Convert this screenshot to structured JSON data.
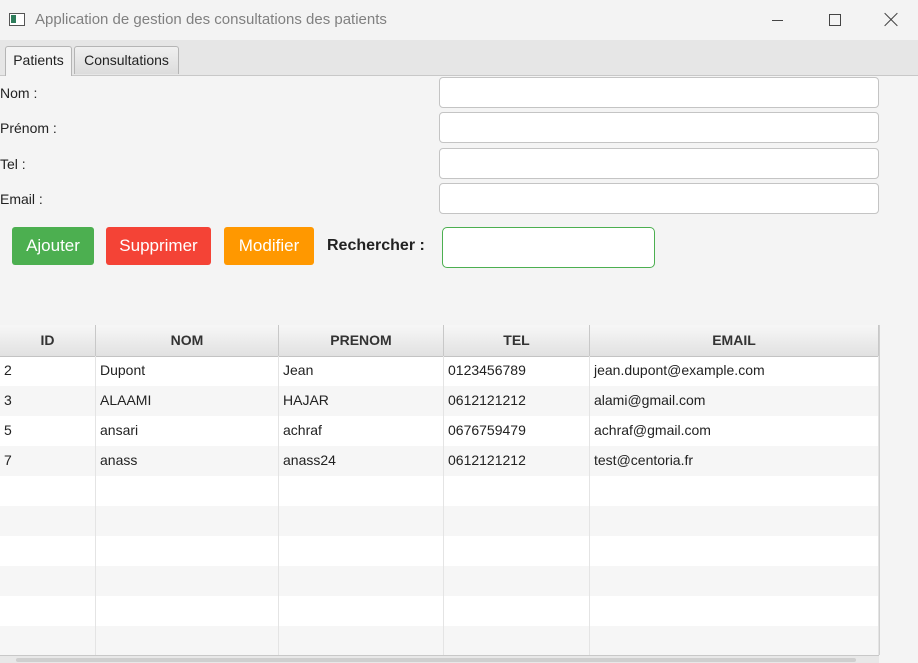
{
  "window": {
    "title": "Application de gestion des consultations des patients"
  },
  "tabs": [
    {
      "label": "Patients"
    },
    {
      "label": "Consultations"
    }
  ],
  "form": {
    "nom_label": "Nom :",
    "prenom_label": "Prénom :",
    "tel_label": "Tel :",
    "email_label": "Email :",
    "nom_value": "",
    "prenom_value": "",
    "tel_value": "",
    "email_value": ""
  },
  "actions": {
    "ajouter": "Ajouter",
    "supprimer": "Supprimer",
    "modifier": "Modifier",
    "rechercher_label": "Rechercher :",
    "search_value": ""
  },
  "colors": {
    "ajouter": "#4caf50",
    "supprimer": "#f44336",
    "modifier": "#ff9800",
    "search_border": "#4caf50"
  },
  "table": {
    "columns": [
      "ID",
      "NOM",
      "PRENOM",
      "TEL",
      "EMAIL"
    ],
    "rows": [
      [
        "2",
        "Dupont",
        "Jean",
        "0123456789",
        "jean.dupont@example.com"
      ],
      [
        "3",
        "ALAAMI",
        "HAJAR",
        "0612121212",
        "alami@gmail.com"
      ],
      [
        "5",
        "ansari",
        "achraf",
        "0676759479",
        "achraf@gmail.com"
      ],
      [
        "7",
        "anass",
        "anass24",
        "0612121212",
        "test@centoria.fr"
      ]
    ]
  },
  "icons": {
    "app": "app-window-icon",
    "minimize": "minimize-icon",
    "maximize": "maximize-icon",
    "close": "close-icon"
  }
}
